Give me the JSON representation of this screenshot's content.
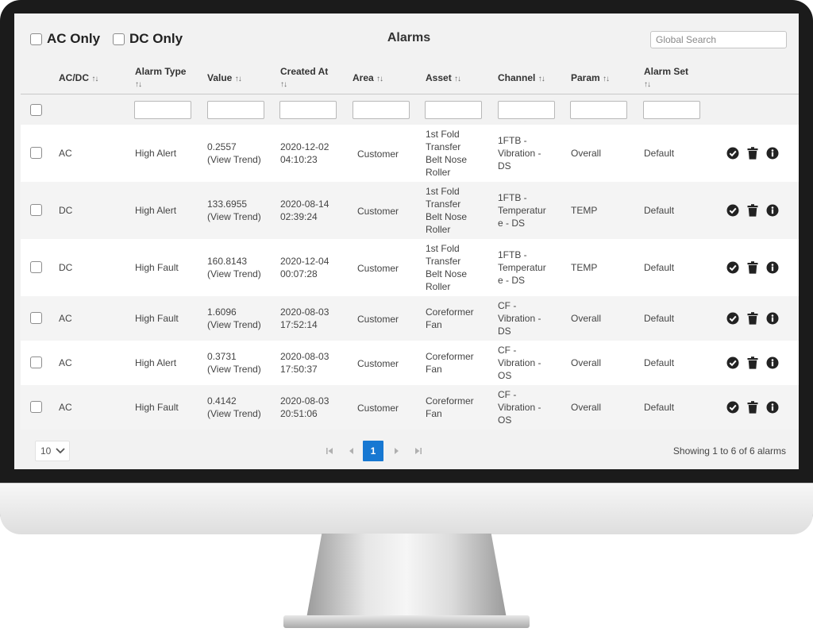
{
  "filters": {
    "ac_only_label": "AC Only",
    "dc_only_label": "DC Only"
  },
  "title": "Alarms",
  "search": {
    "placeholder": "Global Search",
    "value": ""
  },
  "columns": [
    "AC/DC",
    "Alarm Type",
    "Value",
    "Created At",
    "Area",
    "Asset",
    "Channel",
    "Param",
    "Alarm Set"
  ],
  "sort_glyph": "↑↓",
  "rows": [
    {
      "acdc": "AC",
      "type": "High Alert",
      "value": "0.2557",
      "trend": "(View Trend)",
      "date": "2020-12-02",
      "time": "04:10:23",
      "area": "Customer",
      "asset": [
        "1st Fold",
        "Transfer",
        "Belt Nose",
        "Roller"
      ],
      "channel": [
        "1FTB -",
        "Vibration -",
        "DS"
      ],
      "param": "Overall",
      "alarm_set": "Default"
    },
    {
      "acdc": "DC",
      "type": "High Alert",
      "value": "133.6955",
      "trend": "(View Trend)",
      "date": "2020-08-14",
      "time": "02:39:24",
      "area": "Customer",
      "asset": [
        "1st Fold",
        "Transfer",
        "Belt Nose",
        "Roller"
      ],
      "channel": [
        "1FTB -",
        "Temperatur",
        "e - DS"
      ],
      "param": "TEMP",
      "alarm_set": "Default"
    },
    {
      "acdc": "DC",
      "type": "High Fault",
      "value": "160.8143",
      "trend": "(View Trend)",
      "date": "2020-12-04",
      "time": "00:07:28",
      "area": "Customer",
      "asset": [
        "1st Fold",
        "Transfer",
        "Belt Nose",
        "Roller"
      ],
      "channel": [
        "1FTB -",
        "Temperatur",
        "e - DS"
      ],
      "param": "TEMP",
      "alarm_set": "Default"
    },
    {
      "acdc": "AC",
      "type": "High Fault",
      "value": "1.6096",
      "trend": "(View Trend)",
      "date": "2020-08-03",
      "time": "17:52:14",
      "area": "Customer",
      "asset": [
        "Coreformer",
        "Fan"
      ],
      "channel": [
        "CF -",
        "Vibration -",
        "DS"
      ],
      "param": "Overall",
      "alarm_set": "Default"
    },
    {
      "acdc": "AC",
      "type": "High Alert",
      "value": "0.3731",
      "trend": "(View Trend)",
      "date": "2020-08-03",
      "time": "17:50:37",
      "area": "Customer",
      "asset": [
        "Coreformer",
        "Fan"
      ],
      "channel": [
        "CF -",
        "Vibration -",
        "OS"
      ],
      "param": "Overall",
      "alarm_set": "Default"
    },
    {
      "acdc": "AC",
      "type": "High Fault",
      "value": "0.4142",
      "trend": "(View Trend)",
      "date": "2020-08-03",
      "time": "20:51:06",
      "area": "Customer",
      "asset": [
        "Coreformer",
        "Fan"
      ],
      "channel": [
        "CF -",
        "Vibration -",
        "OS"
      ],
      "param": "Overall",
      "alarm_set": "Default"
    }
  ],
  "pagination": {
    "page_size": "10",
    "current_page": "1",
    "showing": "Showing 1 to 6 of 6 alarms"
  },
  "icons": {
    "acknowledge": "check-circle-icon",
    "delete": "trash-icon",
    "info": "info-circle-icon",
    "first": "first-page-icon",
    "prev": "prev-page-icon",
    "next": "next-page-icon",
    "last": "last-page-icon",
    "dropdown": "chevron-down-icon"
  },
  "colors": {
    "accent": "#1778d2",
    "screen_bg": "#f2f2f2",
    "bezel": "#1b1b1b"
  }
}
